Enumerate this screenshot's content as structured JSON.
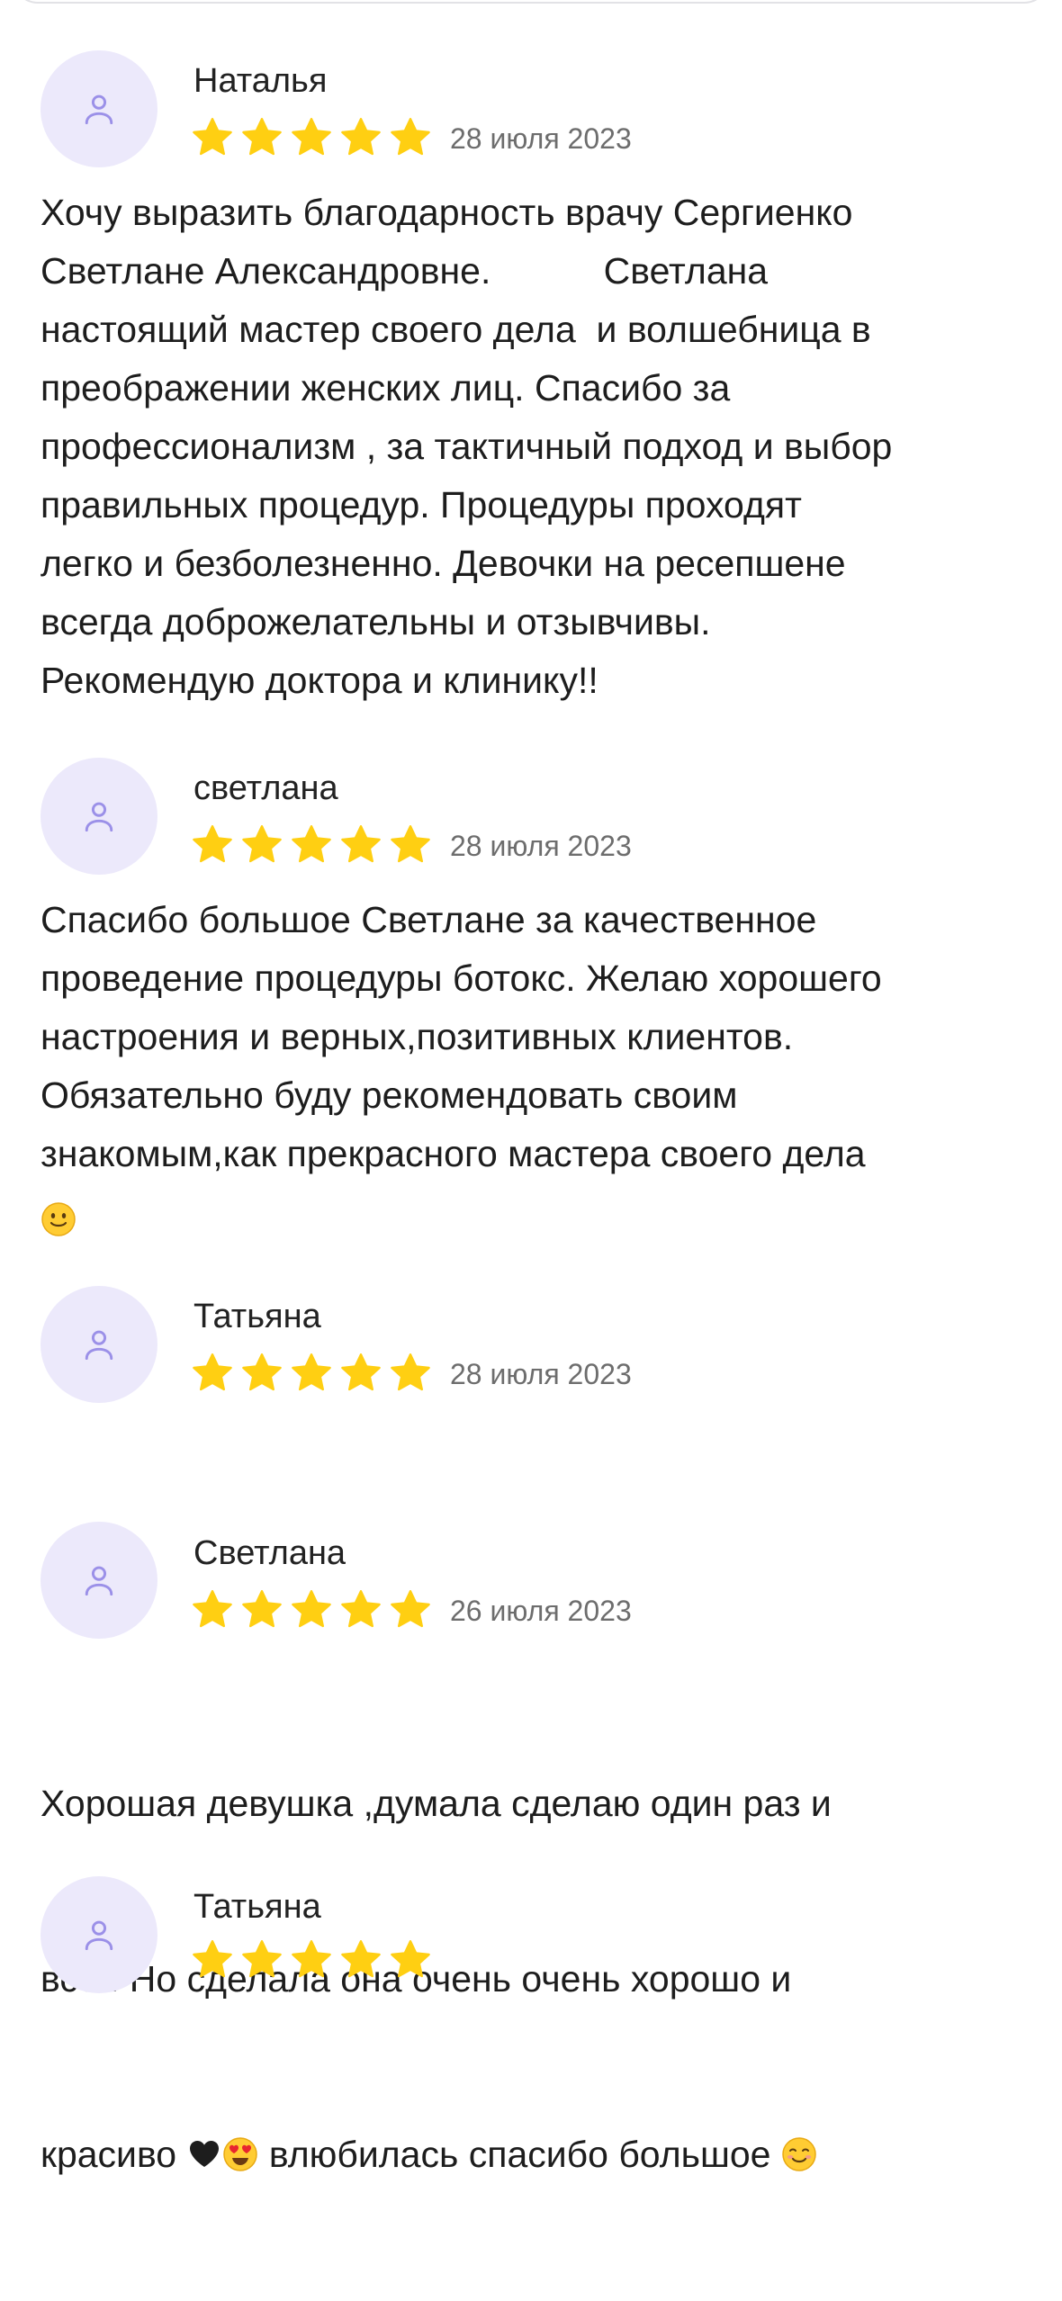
{
  "colors": {
    "avatar_bg": "#ece9fb",
    "avatar_icon": "#9b90e8",
    "star": "#ffcf12",
    "date_text": "#6d6d6d"
  },
  "icons": {
    "avatar": "user-outline-icon",
    "star": "star-filled-icon"
  },
  "reviews": [
    {
      "author": "Наталья",
      "date": "28 июля 2023",
      "rating": 5,
      "text": "Хочу выразить благодарность врачу Сергиенко\nСветлане Александровне.           Светлана\nнастоящий мастер своего дела  и волшебница в\nпреображении женских лиц. Спасибо за\nпрофессионализм , за тактичный подход и выбор\nправильных процедур. Процедуры проходят\nлегко и безболезненно. Девочки на ресепшене\nвсегда доброжелательны и отзывчивы.\nРекомендую доктора и клинику!!"
    },
    {
      "author": "светлана",
      "date": "28 июля 2023",
      "rating": 5,
      "text": "Спасибо большое Светлане за качественное\nпроведение процедуры ботокс. Желаю хорошего\nнастроения и верных,позитивных клиентов.\nОбязательно буду рекомендовать своим\nзнакомым,как прекрасного мастера своего дела",
      "emoji": "slightly-smiling-face-emoji"
    },
    {
      "author": "Татьяна",
      "date": "28 июля 2023",
      "rating": 5,
      "text": ""
    },
    {
      "author": "Светлана",
      "date": "26 июля 2023",
      "rating": 5,
      "text_lines": [
        "Хорошая девушка ,думала сделаю один раз и",
        "всё . Но сделала она очень очень хорошо и"
      ],
      "last_line_start": "красиво ",
      "last_line_mid": " влюбилась спасибо большое ",
      "emojis": [
        "black-heart-emoji",
        "heart-eyes-emoji",
        "smiling-face-emoji"
      ]
    },
    {
      "author": "Татьяна",
      "rating": 5
    }
  ]
}
